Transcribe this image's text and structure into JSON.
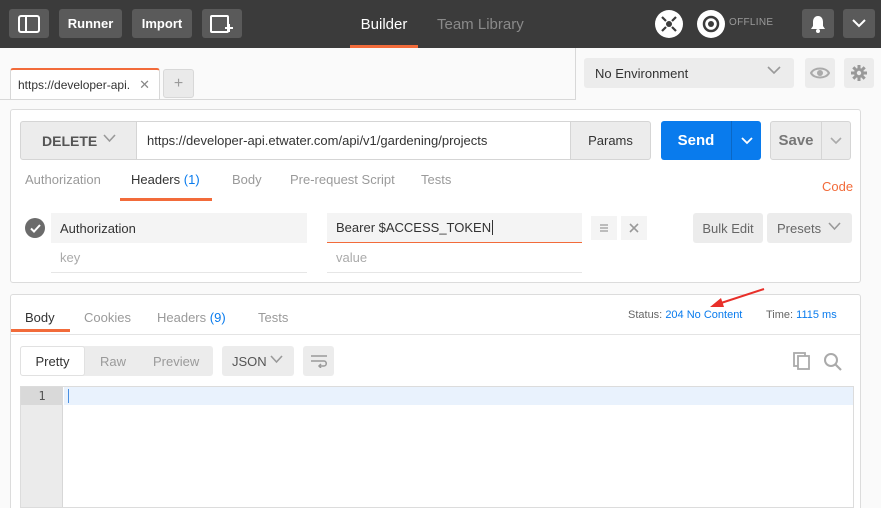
{
  "topbar": {
    "runner_label": "Runner",
    "import_label": "Import",
    "tabs": [
      {
        "label": "Builder",
        "active": true
      },
      {
        "label": "Team Library",
        "active": false
      }
    ],
    "sync_status": "OFFLINE"
  },
  "request_tab": {
    "title": "https://developer-api.",
    "close_glyph": "✕",
    "new_tab_glyph": "+"
  },
  "environment": {
    "selected": "No Environment"
  },
  "request": {
    "method": "DELETE",
    "url": "https://developer-api.etwater.com/api/v1/gardening/projects",
    "params_label": "Params",
    "send_label": "Send",
    "save_label": "Save",
    "subtabs": [
      {
        "label": "Authorization"
      },
      {
        "label": "Headers",
        "count": "(1)",
        "active": true
      },
      {
        "label": "Body"
      },
      {
        "label": "Pre-request Script"
      },
      {
        "label": "Tests"
      }
    ],
    "code_label": "Code",
    "headers": [
      {
        "key": "Authorization",
        "value": "Bearer $ACCESS_TOKEN",
        "enabled": true
      }
    ],
    "key_placeholder": "key",
    "value_placeholder": "value",
    "row_action_icons": [
      "drag-handle-icon",
      "delete-icon"
    ],
    "bulk_edit_label": "Bulk Edit",
    "presets_label": "Presets"
  },
  "response": {
    "tabs": [
      {
        "label": "Body",
        "active": true
      },
      {
        "label": "Cookies"
      },
      {
        "label": "Headers",
        "count": "(9)"
      },
      {
        "label": "Tests"
      }
    ],
    "status_label": "Status:",
    "status_value": "204 No Content",
    "time_label": "Time:",
    "time_value": "1115 ms",
    "formats": [
      "Pretty",
      "Raw",
      "Preview"
    ],
    "active_format": "Pretty",
    "language": "JSON",
    "line_numbers": [
      "1"
    ]
  },
  "colors": {
    "accent_orange": "#f26b3a",
    "link_blue": "#097bed",
    "topbar_bg": "#3b3b3b"
  }
}
